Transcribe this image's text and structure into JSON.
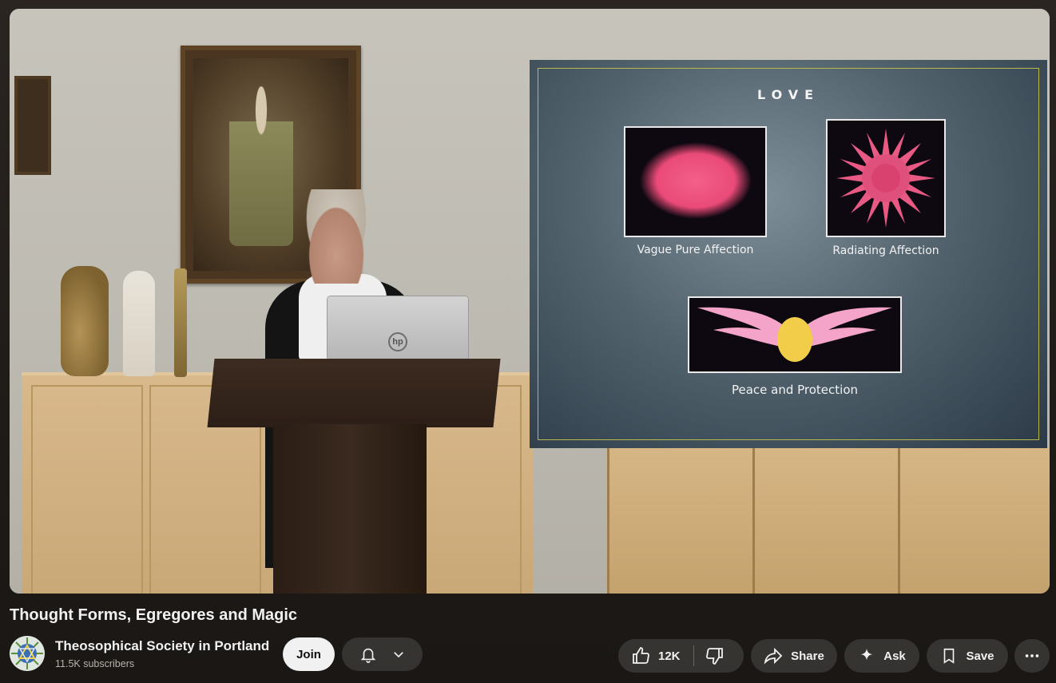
{
  "video": {
    "slide": {
      "title": "LOVE",
      "images": [
        {
          "caption": "Vague Pure Affection"
        },
        {
          "caption": "Radiating Affection"
        },
        {
          "caption": "Peace and Protection"
        }
      ]
    },
    "laptop_logo": "hp"
  },
  "title": "Thought Forms, Egregores and Magic",
  "channel": {
    "name": "Theosophical Society in Portland",
    "subscribers": "11.5K subscribers",
    "join_label": "Join"
  },
  "actions": {
    "like_count": "12K",
    "share_label": "Share",
    "ask_label": "Ask",
    "save_label": "Save"
  },
  "icons": [
    "bell-icon",
    "chevron-down-icon",
    "thumbs-up-icon",
    "thumbs-down-icon",
    "share-icon",
    "sparkle-icon",
    "bookmark-icon",
    "more-icon"
  ]
}
